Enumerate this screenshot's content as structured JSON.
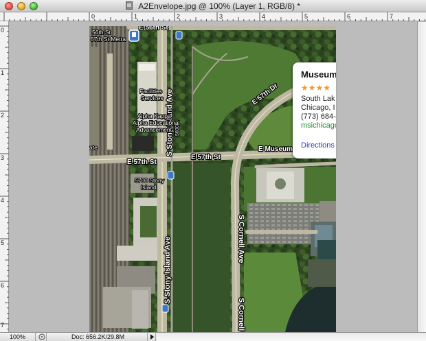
{
  "window": {
    "title": "A2Envelope.jpg @ 100% (Layer 1, RGB/8) *"
  },
  "rulers": {
    "top_labels": [
      "0",
      "1",
      "2",
      "3",
      "4",
      "5",
      "6",
      "7"
    ],
    "left_labels": [
      "0",
      "1",
      "2",
      "3",
      "4",
      "5",
      "6",
      "7"
    ]
  },
  "map": {
    "street_labels": {
      "e56th": "E 56th St",
      "stony_v1": "S Stony Island Ave",
      "stony_v2": "S Stony Island Ave",
      "e57th_left": "E 57th St",
      "e57th_mid": "E 57th St",
      "e57th_dr": "E 57th Dr",
      "museum_dr": "E Museum Dr",
      "cornell_v1": "S Cornell Ave",
      "cornell_v2": "S Cornell",
      "num_5600": "5600"
    },
    "place_labels": {
      "metra_1": "56th St",
      "metra_2": "57th St Metra",
      "facilities_1": "Facilities",
      "facilities_2": "Services",
      "alpha_1": "Alpha Kappa",
      "alpha_2": "Alpha Educational",
      "alpha_3": "Advancement",
      "stony5700_1": "5700 Stony",
      "stony5700_2": "Island",
      "ate": "ate"
    }
  },
  "info_bubble": {
    "name": "Museum",
    "stars": "★★★★",
    "address_1": "South Lak",
    "address_2": "Chicago, I",
    "phone": "(773) 684-",
    "website": "msichicago",
    "directions_link": "Directions"
  },
  "status_bar": {
    "zoom": "100%",
    "doc_size": "Doc: 656.2K/29.8M"
  },
  "colors": {
    "bubble_stars": "#f29b25",
    "website_link": "#1a8a2a",
    "directions_link": "#2a3ccc",
    "transit_marker": "#3a78c8"
  }
}
